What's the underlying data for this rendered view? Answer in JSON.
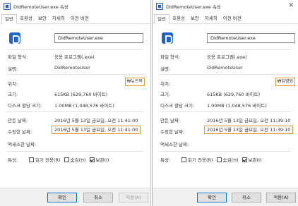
{
  "left": {
    "title": "DidRemoteUser.exe 속성",
    "close": "✕",
    "tabs": [
      "일반",
      "호환성",
      "보안",
      "자세히",
      "이전 버전"
    ],
    "file_name": "DidRemoteUser.exe",
    "labels": {
      "type": "파일 형식:",
      "desc": "설명:",
      "location": "위치:",
      "size": "크기:",
      "size_on_disk": "디스크 할당 크기:",
      "created": "만든 날짜:",
      "modified": "수정한 날짜:",
      "accessed": "액세스한 날짜:",
      "attributes": "특성:"
    },
    "values": {
      "type": "응용 프로그램(.exe)",
      "desc": "DidRemoteUser",
      "location": "₩뉴트목",
      "size": "615KB (629,760 바이트)",
      "size_on_disk": "1.00MB (1,048,576 바이트)",
      "created": "2016년 5월 13일 금요일, 오전 11:41:00",
      "modified": "2016년 5월 13일 금요일, 오전 11:41:00",
      "accessed": ""
    },
    "attributes": [
      {
        "label": "읽기 전용(R)",
        "checked": false
      },
      {
        "label": "숨김(H)",
        "checked": false
      },
      {
        "label": "보관(I)",
        "checked": true
      }
    ],
    "buttons": {
      "ok": "확인",
      "cancel": "취소",
      "apply": "적용(A)"
    }
  },
  "right": {
    "title": "DidRemoteUser.exe 속성",
    "close": "✕",
    "tabs": [
      "일반",
      "호환성",
      "보안",
      "자세히",
      "이전 버전"
    ],
    "file_name": "DidRemoteUser.exe",
    "labels": {
      "type": "파일 형식:",
      "desc": "설명:",
      "location": "위치:",
      "size": "크기:",
      "size_on_disk": "디스크 할당 크기:",
      "created": "만든 날짜:",
      "modified": "수정한 날짜:",
      "accessed": "액세스한 날짜:",
      "attributes": "특성:"
    },
    "values": {
      "type": "응용 프로그램(.exe)",
      "desc": "DidRemoteUser",
      "location": "₩입병원",
      "size": "615KB (629,760 바이트)",
      "size_on_disk": "1.00MB (1,048,576 바이트)",
      "created": "2016년 5월 13일 금요일, 오전 11:39:10",
      "modified": "2016년 5월 13일 금요일, 오전 11:39:10",
      "accessed": ""
    },
    "attributes": [
      {
        "label": "읽기 전용(R)",
        "checked": false
      },
      {
        "label": "숨김(H)",
        "checked": false
      },
      {
        "label": "보관(I)",
        "checked": true
      }
    ],
    "buttons": {
      "ok": "확인",
      "cancel": "취소",
      "apply": "적용(A)"
    }
  },
  "colors": {
    "highlight": "#e69a2a",
    "accent": "#0078d7"
  }
}
